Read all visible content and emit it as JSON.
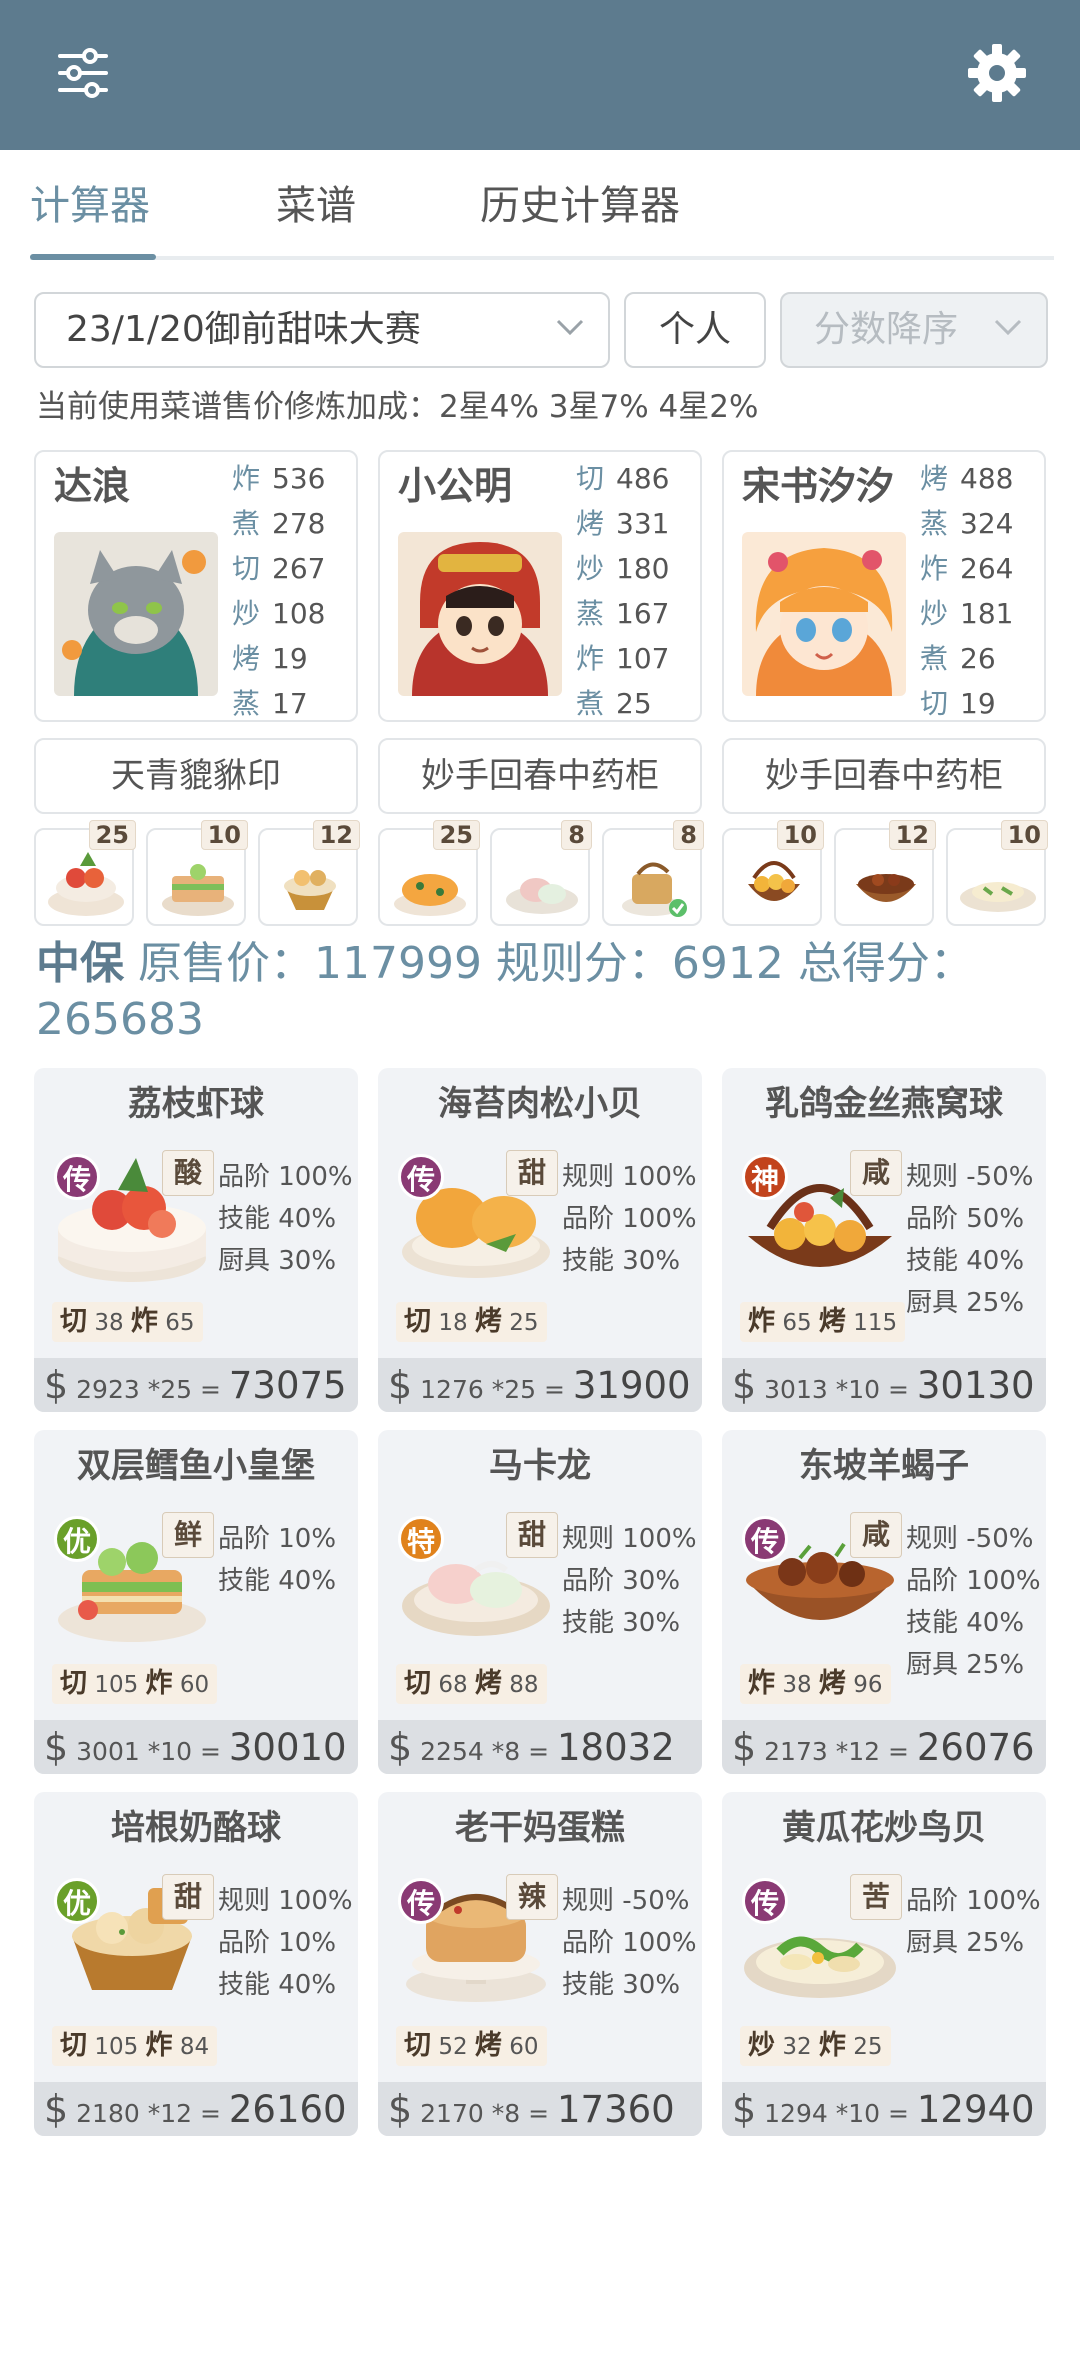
{
  "header": {
    "menu_icon": "sliders-icon",
    "settings_icon": "gear-icon",
    "bar_color": "#5d7b8e"
  },
  "tabs": [
    {
      "label": "计算器",
      "active": true
    },
    {
      "label": "菜谱",
      "active": false
    },
    {
      "label": "历史计算器",
      "active": false
    }
  ],
  "filters": {
    "contest": "23/1/20御前甜味大赛",
    "mode": "个人",
    "sort": "分数降序"
  },
  "bonus_text": "当前使用菜谱售价修炼加成：2星4% 3星7% 4星2%",
  "chefs": [
    {
      "name": "达浪",
      "skills": [
        {
          "k": "炸",
          "v": "536"
        },
        {
          "k": "煮",
          "v": "278"
        },
        {
          "k": "切",
          "v": "267"
        },
        {
          "k": "炒",
          "v": "108"
        },
        {
          "k": "烤",
          "v": "19"
        },
        {
          "k": "蒸",
          "v": "17"
        }
      ],
      "equip": "天青貔貅印"
    },
    {
      "name": "小公明",
      "skills": [
        {
          "k": "切",
          "v": "486"
        },
        {
          "k": "烤",
          "v": "331"
        },
        {
          "k": "炒",
          "v": "180"
        },
        {
          "k": "蒸",
          "v": "167"
        },
        {
          "k": "炸",
          "v": "107"
        },
        {
          "k": "煮",
          "v": "25"
        }
      ],
      "equip": "妙手回春中药柜"
    },
    {
      "name": "宋书汐汐",
      "skills": [
        {
          "k": "烤",
          "v": "488"
        },
        {
          "k": "蒸",
          "v": "324"
        },
        {
          "k": "炸",
          "v": "264"
        },
        {
          "k": "炒",
          "v": "181"
        },
        {
          "k": "煮",
          "v": "26"
        },
        {
          "k": "切",
          "v": "19"
        }
      ],
      "equip": "妙手回春中药柜"
    }
  ],
  "ingredients": [
    "25",
    "10",
    "12",
    "25",
    "8",
    "8",
    "10",
    "12",
    "10"
  ],
  "summary": {
    "level": "中保",
    "text": " 原售价：117999 规则分：6912 总得分：265683"
  },
  "dishes": [
    {
      "name": "荔枝虾球",
      "rarity": "传",
      "flavor": "酸",
      "buffs": [
        "品阶 100%",
        "技能 40%",
        "厨具 30%"
      ],
      "s1k": "切",
      "s1v": "38",
      "s2k": "炸",
      "s2v": "65",
      "price": "2923",
      "mult": "*25",
      "total": "73075"
    },
    {
      "name": "海苔肉松小贝",
      "rarity": "传",
      "flavor": "甜",
      "buffs": [
        "规则 100%",
        "品阶 100%",
        "技能 30%"
      ],
      "s1k": "切",
      "s1v": "18",
      "s2k": "烤",
      "s2v": "25",
      "price": "1276",
      "mult": "*25",
      "total": "31900"
    },
    {
      "name": "乳鸽金丝燕窝球",
      "rarity": "神",
      "flavor": "咸",
      "buffs": [
        "规则 -50%",
        "品阶 50%",
        "技能 40%",
        "厨具 25%"
      ],
      "s1k": "炸",
      "s1v": "65",
      "s2k": "烤",
      "s2v": "115",
      "price": "3013",
      "mult": "*10",
      "total": "30130"
    },
    {
      "name": "双层鳕鱼小皇堡",
      "rarity": "优",
      "flavor": "鲜",
      "buffs": [
        "品阶 10%",
        "技能 40%"
      ],
      "s1k": "切",
      "s1v": "105",
      "s2k": "炸",
      "s2v": "60",
      "price": "3001",
      "mult": "*10",
      "total": "30010"
    },
    {
      "name": "马卡龙",
      "rarity": "特",
      "flavor": "甜",
      "buffs": [
        "规则 100%",
        "品阶 30%",
        "技能 30%"
      ],
      "s1k": "切",
      "s1v": "68",
      "s2k": "烤",
      "s2v": "88",
      "price": "2254",
      "mult": "*8",
      "total": "18032"
    },
    {
      "name": "东坡羊蝎子",
      "rarity": "传",
      "flavor": "咸",
      "buffs": [
        "规则 -50%",
        "品阶 100%",
        "技能 40%",
        "厨具 25%"
      ],
      "s1k": "炸",
      "s1v": "38",
      "s2k": "烤",
      "s2v": "96",
      "price": "2173",
      "mult": "*12",
      "total": "26076"
    },
    {
      "name": "培根奶酪球",
      "rarity": "优",
      "flavor": "甜",
      "buffs": [
        "规则 100%",
        "品阶 10%",
        "技能 40%"
      ],
      "s1k": "切",
      "s1v": "105",
      "s2k": "炸",
      "s2v": "84",
      "price": "2180",
      "mult": "*12",
      "total": "26160"
    },
    {
      "name": "老干妈蛋糕",
      "rarity": "传",
      "flavor": "辣",
      "buffs": [
        "规则 -50%",
        "品阶 100%",
        "技能 30%"
      ],
      "s1k": "切",
      "s1v": "52",
      "s2k": "烤",
      "s2v": "60",
      "price": "2170",
      "mult": "*8",
      "total": "17360"
    },
    {
      "name": "黄瓜花炒鸟贝",
      "rarity": "传",
      "flavor": "苦",
      "buffs": [
        "品阶 100%",
        "厨具 25%"
      ],
      "s1k": "炒",
      "s1v": "32",
      "s2k": "炸",
      "s2v": "25",
      "price": "1294",
      "mult": "*10",
      "total": "12940"
    }
  ],
  "currency_symbol": "$",
  "equals": "="
}
